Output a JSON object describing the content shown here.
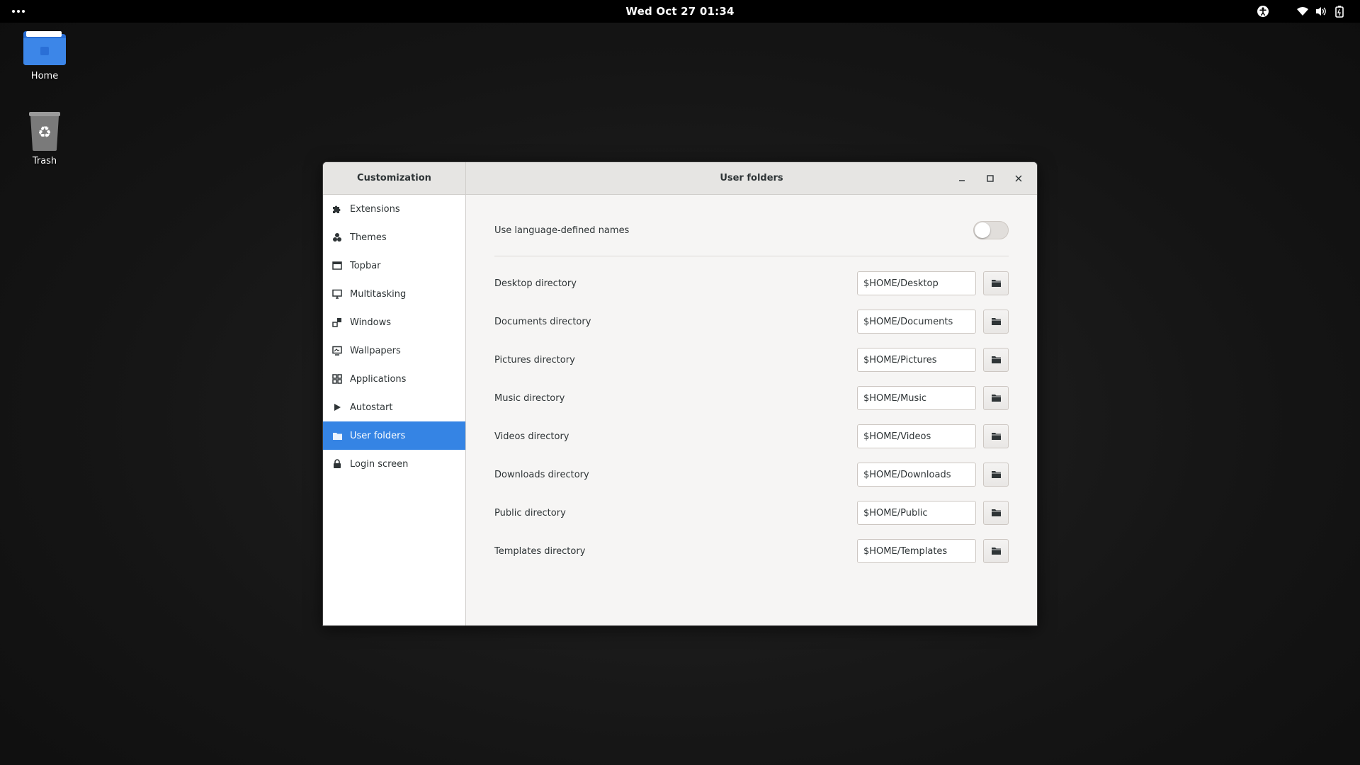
{
  "topbar": {
    "activities_icon": "dots-icon",
    "clock": "Wed Oct 27  01:34",
    "tray_icons": [
      "accessibility-icon",
      "wifi-icon",
      "volume-icon",
      "battery-icon"
    ]
  },
  "desktop": {
    "icons": [
      {
        "label": "Home",
        "icon": "folder-home-icon"
      },
      {
        "label": "Trash",
        "icon": "trash-icon"
      }
    ]
  },
  "window": {
    "sidebar_title": "Customization",
    "page_title": "User folders",
    "buttons": {
      "minimize": "minimize-icon",
      "maximize": "maximize-icon",
      "close": "close-icon"
    },
    "accent_color": "#3584e4",
    "sidebar_items": [
      {
        "label": "Extensions",
        "icon": "puzzle-icon"
      },
      {
        "label": "Themes",
        "icon": "palette-icon"
      },
      {
        "label": "Topbar",
        "icon": "topbar-icon"
      },
      {
        "label": "Multitasking",
        "icon": "monitor-icon"
      },
      {
        "label": "Windows",
        "icon": "windows-icon"
      },
      {
        "label": "Wallpapers",
        "icon": "wallpaper-icon"
      },
      {
        "label": "Applications",
        "icon": "grid-icon"
      },
      {
        "label": "Autostart",
        "icon": "play-icon"
      },
      {
        "label": "User folders",
        "icon": "folder-icon",
        "active": true
      },
      {
        "label": "Login screen",
        "icon": "lock-icon"
      }
    ],
    "language_names": {
      "label": "Use language-defined names",
      "enabled": false
    },
    "directories": [
      {
        "label": "Desktop directory",
        "value": "$HOME/Desktop"
      },
      {
        "label": "Documents directory",
        "value": "$HOME/Documents"
      },
      {
        "label": "Pictures directory",
        "value": "$HOME/Pictures"
      },
      {
        "label": "Music directory",
        "value": "$HOME/Music"
      },
      {
        "label": "Videos directory",
        "value": "$HOME/Videos"
      },
      {
        "label": "Downloads directory",
        "value": "$HOME/Downloads"
      },
      {
        "label": "Public directory",
        "value": "$HOME/Public"
      },
      {
        "label": "Templates directory",
        "value": "$HOME/Templates"
      }
    ]
  }
}
